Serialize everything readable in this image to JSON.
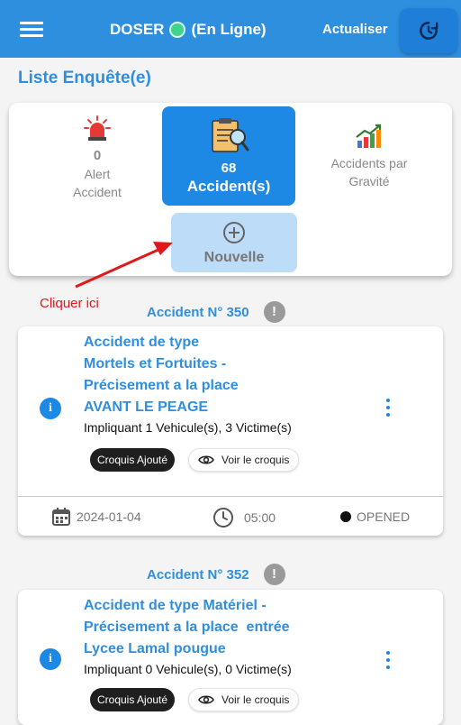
{
  "appbar": {
    "title": "DOSER",
    "status": "(En Ligne)",
    "refresh_label": "Actualiser"
  },
  "page": {
    "title": "Liste Enquête(e)"
  },
  "stats": {
    "alert": {
      "count": "0",
      "label_line1": "Alert",
      "label_line2": "Accident"
    },
    "accidents": {
      "count": "68",
      "label": "Accident(s)"
    },
    "gravity": {
      "label_line1": "Accidents par",
      "label_line2": "Gravité"
    },
    "new_label": "Nouvelle"
  },
  "hint": "Cliquer ici",
  "accidents": [
    {
      "heading": "Accident N° 350",
      "title_lines": [
        "Accident de type",
        "Mortels et Fortuites -",
        "Précisement a la place",
        "AVANT LE PEAGE"
      ],
      "involving": "Impliquant 1 Vehicule(s), 3 Victime(s)",
      "chip_sketch": "Croquis Ajouté",
      "view_sketch": "Voir le croquis",
      "date": "2024-01-04",
      "time": "05:00",
      "status": "OPENED"
    },
    {
      "heading": "Accident N° 352",
      "title_lines": [
        "Accident de type Matériel -",
        "Précisement a la place  entrée",
        "Lycee Lamal pougue"
      ],
      "involving": "Impliquant 0 Vehicule(s), 0 Victime(s)",
      "chip_sketch": "Croquis Ajouté",
      "view_sketch": "Voir le croquis"
    }
  ],
  "colors": {
    "primary": "#2f8fdf",
    "accent_button": "#1e88e5",
    "online": "#3ed48a",
    "hint": "#e0181c"
  }
}
